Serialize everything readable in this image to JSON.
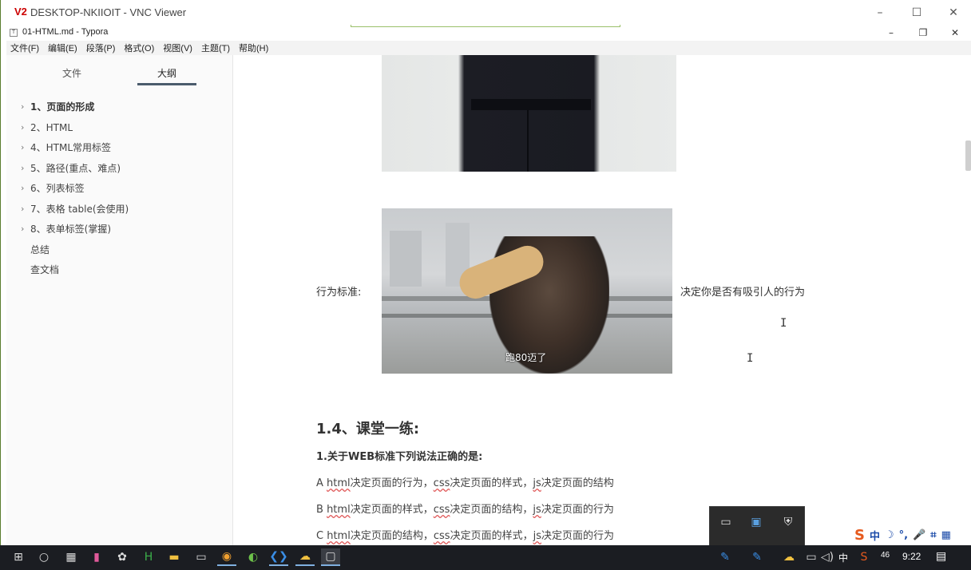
{
  "vnc": {
    "logo": "V2",
    "title": "DESKTOP-NKIIOIT - VNC Viewer",
    "minimize": "–",
    "maximize": "☐",
    "close": "✕"
  },
  "typora": {
    "app_icon": "T",
    "title": "01-HTML.md - Typora",
    "minimize": "–",
    "restore": "❐",
    "close": "✕",
    "menu": [
      "文件(F)",
      "编辑(E)",
      "段落(P)",
      "格式(O)",
      "视图(V)",
      "主题(T)",
      "帮助(H)"
    ]
  },
  "sidebar": {
    "tab_files": "文件",
    "tab_outline": "大纲",
    "outline": [
      {
        "label": "1、页面的形成",
        "chevron": "›",
        "active": true
      },
      {
        "label": "2、HTML",
        "chevron": "›"
      },
      {
        "label": "4、HTML常用标签",
        "chevron": "›"
      },
      {
        "label": "5、路径(重点、难点)",
        "chevron": "›"
      },
      {
        "label": "6、列表标签",
        "chevron": "›"
      },
      {
        "label": "7、表格 table(会使用)",
        "chevron": "›"
      },
      {
        "label": "8、表单标签(掌握)",
        "chevron": "›"
      },
      {
        "label": "总结",
        "chevron": ""
      },
      {
        "label": "查文档",
        "chevron": ""
      }
    ],
    "bottom_back": "‹",
    "bottom_source": "</>"
  },
  "editor": {
    "behavior_label": "行为标准:",
    "behavior_desc": "决定你是否有吸引人的行为",
    "gif_caption": "跑80迈了",
    "heading": "1.4、课堂一练:",
    "question": "1.关于WEB标准下列说法正确的是:",
    "options": [
      {
        "prefix": "A ",
        "w1": "html",
        "t1": "决定页面的行为，",
        "w2": "css",
        "t2": "决定页面的样式，",
        "w3": "js",
        "t3": "决定页面的结构"
      },
      {
        "prefix": "B ",
        "w1": "html",
        "t1": "决定页面的样式，",
        "w2": "css",
        "t2": "决定页面的结构，",
        "w3": "js",
        "t3": "决定页面的行为"
      },
      {
        "prefix": "C ",
        "w1": "html",
        "t1": "决定页面的结构，",
        "w2": "css",
        "t2": "决定页面的样式，",
        "w3": "js",
        "t3": "决定页面的行为"
      }
    ]
  },
  "ime": {
    "logo": "S",
    "mode": "中",
    "moon": "☽",
    "punct": "°,",
    "mic": "🎤",
    "crop": "⌗",
    "grid": "▦"
  },
  "taskbar": {
    "tray_lang": "中",
    "tray_num": "46",
    "clock": "9:22",
    "notif": "▤"
  },
  "colors": {
    "sidebar_underline": "#4a5b6c",
    "taskbar": "#1b1d22",
    "spell_underline": "#e05a5a"
  }
}
